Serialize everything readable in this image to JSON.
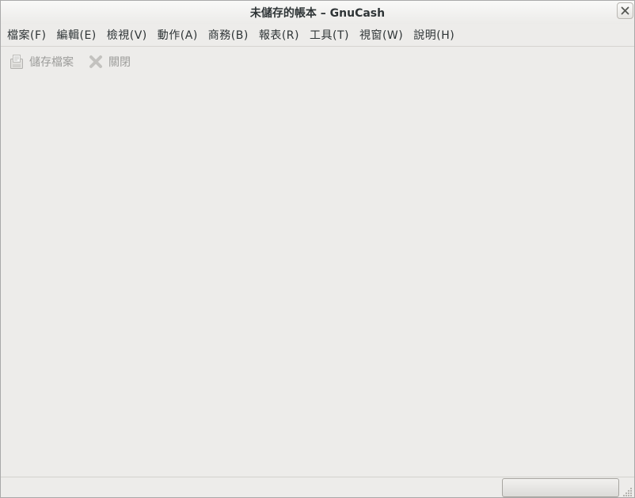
{
  "window": {
    "title": "未儲存的帳本 – GnuCash"
  },
  "menubar": {
    "items": [
      {
        "label": "檔案(F)"
      },
      {
        "label": "編輯(E)"
      },
      {
        "label": "檢視(V)"
      },
      {
        "label": "動作(A)"
      },
      {
        "label": "商務(B)"
      },
      {
        "label": "報表(R)"
      },
      {
        "label": "工具(T)"
      },
      {
        "label": "視窗(W)"
      },
      {
        "label": "說明(H)"
      }
    ]
  },
  "toolbar": {
    "save": {
      "label": "儲存檔案",
      "icon": "save-icon",
      "enabled": false
    },
    "close": {
      "label": "關閉",
      "icon": "close-icon",
      "enabled": false
    }
  },
  "statusbar": {
    "text": ""
  },
  "colors": {
    "background": "#edecea",
    "text": "#2e3436",
    "disabled_text": "#9c9c9a"
  }
}
